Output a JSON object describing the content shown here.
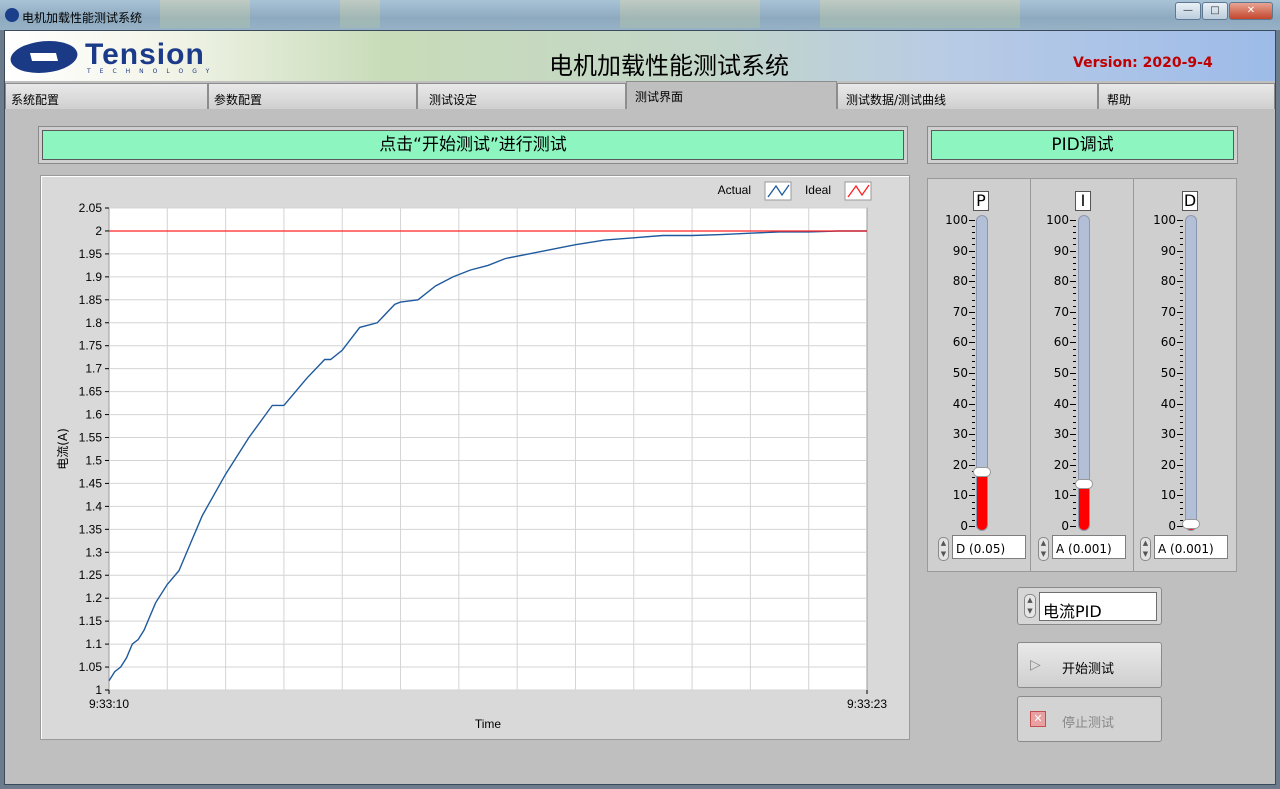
{
  "window": {
    "title": "电机加载性能测试系统"
  },
  "header": {
    "logo_text": "Tension",
    "logo_sub": "TECHNOLOGY",
    "title": "电机加载性能测试系统",
    "version": "Version: 2020-9-4"
  },
  "tabs": [
    {
      "label": "系统配置"
    },
    {
      "label": "参数配置"
    },
    {
      "label": "测试设定"
    },
    {
      "label": "测试界面",
      "active": true
    },
    {
      "label": "测试数据/测试曲线"
    },
    {
      "label": "帮助"
    }
  ],
  "status_banner": "点击“开始测试”进行测试",
  "pid_banner": "PID调试",
  "colors": {
    "banner": "#8cf5c0",
    "actual_line": "#1f5a9e",
    "ideal_line": "#ff2020",
    "slider_fill": "#ff0000",
    "version": "#c00000"
  },
  "chart_data": {
    "type": "line",
    "xlabel": "Time",
    "ylabel": "电流(A)",
    "x_tick_labels": [
      "9:33:10",
      "9:33:23"
    ],
    "ylim": [
      1,
      2.05
    ],
    "y_ticks": [
      "1",
      "1.05",
      "1.1",
      "1.15",
      "1.2",
      "1.25",
      "1.3",
      "1.35",
      "1.4",
      "1.45",
      "1.5",
      "1.55",
      "1.6",
      "1.65",
      "1.7",
      "1.75",
      "1.8",
      "1.85",
      "1.9",
      "1.95",
      "2",
      "2.05"
    ],
    "grid": true,
    "legend_position": "top-right",
    "series": [
      {
        "name": "Actual",
        "color": "#1f5a9e",
        "x": [
          0,
          0.1,
          0.2,
          0.3,
          0.4,
          0.5,
          0.6,
          0.8,
          1.0,
          1.2,
          1.4,
          1.6,
          2.0,
          2.4,
          2.8,
          3.0,
          3.4,
          3.7,
          3.8,
          4.0,
          4.3,
          4.6,
          4.9,
          5.0,
          5.3,
          5.6,
          5.9,
          6.2,
          6.5,
          6.8,
          7.2,
          7.6,
          8.0,
          8.5,
          9.0,
          9.5,
          10.0,
          10.5,
          11.0,
          11.5,
          12.0,
          12.5,
          13.0
        ],
        "y": [
          1.02,
          1.04,
          1.05,
          1.07,
          1.1,
          1.11,
          1.13,
          1.19,
          1.23,
          1.26,
          1.32,
          1.38,
          1.47,
          1.55,
          1.62,
          1.62,
          1.68,
          1.72,
          1.72,
          1.74,
          1.79,
          1.8,
          1.84,
          1.845,
          1.85,
          1.88,
          1.9,
          1.915,
          1.925,
          1.94,
          1.95,
          1.96,
          1.97,
          1.98,
          1.985,
          1.99,
          1.99,
          1.992,
          1.995,
          1.998,
          1.998,
          2.0,
          2.0
        ]
      },
      {
        "name": "Ideal",
        "color": "#ff2020",
        "x": [
          0,
          13.0
        ],
        "y": [
          2.0,
          2.0
        ]
      }
    ]
  },
  "pid": {
    "scale_labels": [
      "100",
      "90",
      "80",
      "70",
      "60",
      "50",
      "40",
      "30",
      "20",
      "10",
      "0"
    ],
    "sliders": [
      {
        "label": "P",
        "value": 17,
        "ring_value": "D (0.05)"
      },
      {
        "label": "I",
        "value": 13,
        "ring_value": "A (0.001)"
      },
      {
        "label": "D",
        "value": 0,
        "ring_value": "A (0.001)"
      }
    ]
  },
  "mode_select": "电流PID",
  "buttons": {
    "start": "开始测试",
    "stop": "停止测试"
  }
}
